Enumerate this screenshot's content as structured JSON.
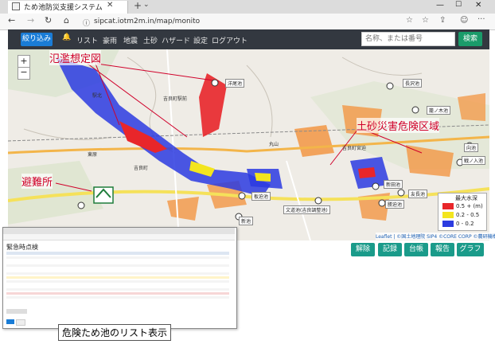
{
  "browser": {
    "tab_title": "ため池防災支援システム |",
    "url": "sipcat.iotm2m.in/map/monito",
    "nav_back": "←",
    "nav_forward": "→",
    "nav_reload": "↻",
    "nav_home": "⌂"
  },
  "app": {
    "filter_button": "絞り込み",
    "menu": [
      "リスト",
      "豪雨",
      "地震",
      "土砂",
      "ハザード",
      "設定",
      "ログアウト"
    ],
    "search_placeholder": "名称、または番号",
    "search_button": "検索"
  },
  "annotations": {
    "flood": "氾濫想定図",
    "landslide": "土砂災害危険区域",
    "shelter": "避難所",
    "list": "危険ため池のリスト表示"
  },
  "pond_labels": [
    "洋尾池",
    "長沢池",
    "籠ノ木池",
    "向池",
    "戦ノ入池",
    "新田池",
    "友長池",
    "勝迫池",
    "文道池(吉良調整池)",
    "板迫池",
    "新池"
  ],
  "place_labels": [
    "吉良町駅前",
    "吉良町",
    "吉良町宮迫",
    "丸山",
    "駅北",
    "東原"
  ],
  "legend": {
    "title": "最大水深",
    "items": [
      {
        "label": "0.5 + (m)",
        "color": "#e8262a"
      },
      {
        "label": "0.2 - 0.5",
        "color": "#f3e51e"
      },
      {
        "label": "0 - 0.2",
        "color": "#2c3be0"
      }
    ]
  },
  "attribution": "Leaflet | ©国土地理院 SIP4 ©CORE CORP ©農研機構",
  "bottom_buttons": [
    "解除",
    "記録",
    "台帳",
    "報告",
    "グラフ"
  ],
  "inset": {
    "title": "緊急時点検"
  },
  "colors": {
    "appbar": "#333840",
    "filter_button": "#1a7cd6",
    "action_button": "#1a9b8a",
    "annotation": "#d0002a"
  }
}
